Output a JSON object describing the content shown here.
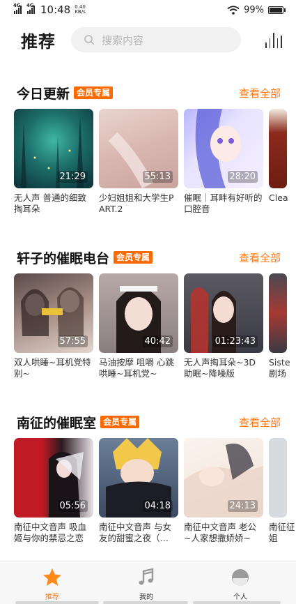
{
  "status_bar": {
    "network1": "4G",
    "network2": "4G",
    "time": "10:48",
    "speed_value": "0.40",
    "speed_unit": "KB/s",
    "battery": "99%"
  },
  "header": {
    "title": "推荐",
    "search_placeholder": "搜索内容"
  },
  "sections": [
    {
      "title": "今日更新",
      "badge": "会员专属",
      "see_all": "查看全部",
      "cards": [
        {
          "duration": "21:29",
          "title": "无人声 普通的细致掏耳朵"
        },
        {
          "duration": "55:13",
          "title": "少妇姐姐和大学生PART.2"
        },
        {
          "duration": "28:20",
          "title": "催眠｜耳畔有好听的口腔音"
        },
        {
          "duration": "",
          "title": "Clea"
        }
      ]
    },
    {
      "title": "轩子的催眠电台",
      "badge": "会员专属",
      "see_all": "查看全部",
      "cards": [
        {
          "duration": "57:55",
          "title": "双人哄睡~耳机党特别~"
        },
        {
          "duration": "40:42",
          "title": "马油按摩 咀嚼 心跳 哄睡~耳机党~"
        },
        {
          "duration": "01:23:43",
          "title": "无人声掏耳朵~3D助眠~降噪版"
        },
        {
          "duration": "",
          "title": "Siste剧场"
        }
      ]
    },
    {
      "title": "南征的催眠室",
      "badge": "会员专属",
      "see_all": "查看全部",
      "cards": [
        {
          "duration": "05:56",
          "title": "南征中文音声 吸血姬与你的禁忌之恋"
        },
        {
          "duration": "04:18",
          "title": "南征中文音声 与女友的甜蜜之夜（…"
        },
        {
          "duration": "24:13",
          "title": "南征中文音声 老公~人家想撒娇娇~"
        },
        {
          "duration": "",
          "title": "南征征姐"
        }
      ]
    }
  ],
  "tabs": [
    {
      "label": "推荐",
      "icon": "star-icon",
      "active": true
    },
    {
      "label": "我的",
      "icon": "music-note-icon",
      "active": false
    },
    {
      "label": "个人",
      "icon": "profile-circle-icon",
      "active": false
    }
  ],
  "colors": {
    "accent": "#ff7a1a",
    "badge": "#ff6a00",
    "search_bg": "#f1f1f1"
  }
}
